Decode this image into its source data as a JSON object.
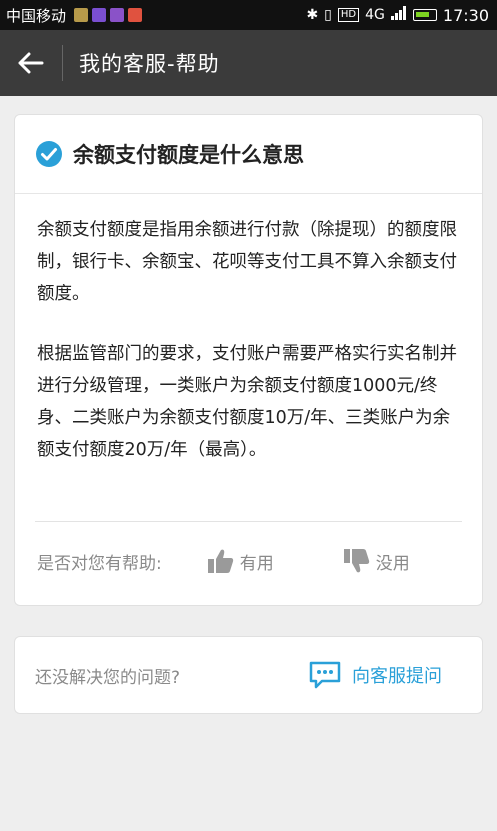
{
  "status_bar": {
    "carrier": "中国移动",
    "hd": "HD",
    "network": "4G",
    "time": "17:30",
    "app_icon_colors": [
      "#b79a4a",
      "#7a4fd0",
      "#8a52c8",
      "#e0523f"
    ]
  },
  "header": {
    "back_icon": "arrow-left-icon",
    "title": "我的客服-帮助",
    "background": "#3b3b3b"
  },
  "article": {
    "check_icon": "check-circle-icon",
    "title": "余额支付额度是什么意思",
    "paragraphs": [
      "余额支付额度是指用余额进行付款（除提现）的额度限制，银行卡、余额宝、花呗等支付工具不算入余额支付额度。",
      "根据监管部门的要求，支付账户需要严格实行实名制并进行分级管理，一类账户为余额支付额度1000元/终身、二类账户为余额支付额度10万/年、三类账户为余额支付额度20万/年（最高）。"
    ]
  },
  "feedback": {
    "question": "是否对您有帮助:",
    "yes_label": "有用",
    "no_label": "没用",
    "yes_icon": "thumbs-up-icon",
    "no_icon": "thumbs-down-icon"
  },
  "ask": {
    "prompt": "还没解决您的问题?",
    "button_label": "向客服提问",
    "icon": "chat-bubble-icon",
    "accent": "#2aa0d8"
  }
}
